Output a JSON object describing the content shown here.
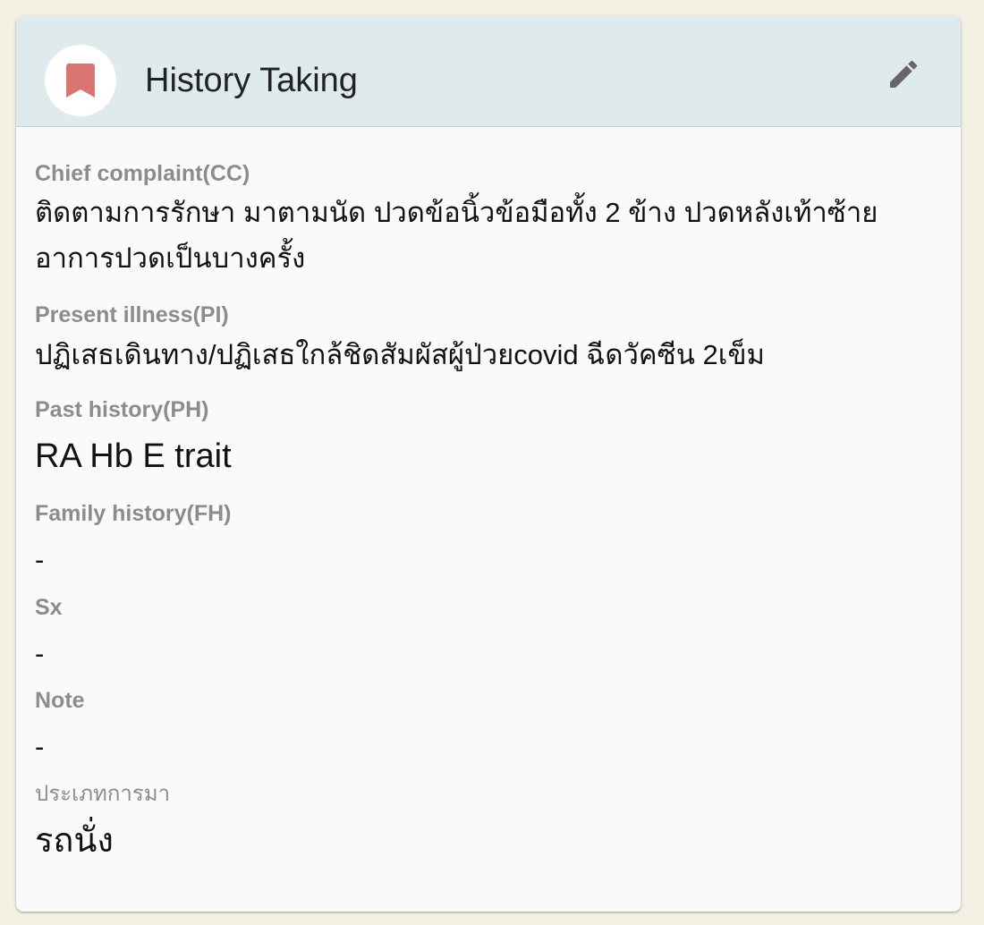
{
  "header": {
    "title": "History Taking",
    "avatar_icon": "bookmark-icon",
    "avatar_icon_color": "#d97572",
    "edit_icon": "pencil-icon",
    "edit_icon_color": "#666666"
  },
  "fields": {
    "cc": {
      "label": "Chief complaint(CC)",
      "value": "ติดตามการรักษา มาตามนัด ปวดข้อนิ้วข้อมือทั้ง 2 ข้าง ปวดหลังเท้าซ้ายอาการปวดเป็นบางครั้ง"
    },
    "pi": {
      "label": "Present illness(PI)",
      "value": "ปฏิเสธเดินทาง/ปฏิเสธใกล้ชิดสัมผัสผู้ป่วยcovid ฉีดวัคซีน 2เข็ม"
    },
    "ph": {
      "label": "Past history(PH)",
      "value": "RA Hb E trait"
    },
    "fh": {
      "label": "Family history(FH)",
      "value": "-"
    },
    "sx": {
      "label": "Sx",
      "value": "-"
    },
    "note": {
      "label": "Note",
      "value": "-"
    },
    "visit_type": {
      "label": "ประเภทการมา",
      "value": "รถนั่ง"
    }
  },
  "colors": {
    "header_background": "#dfeaec",
    "page_background": "#f3f0e4",
    "card_background": "#fafafa",
    "label_color": "#8c8c8c"
  }
}
